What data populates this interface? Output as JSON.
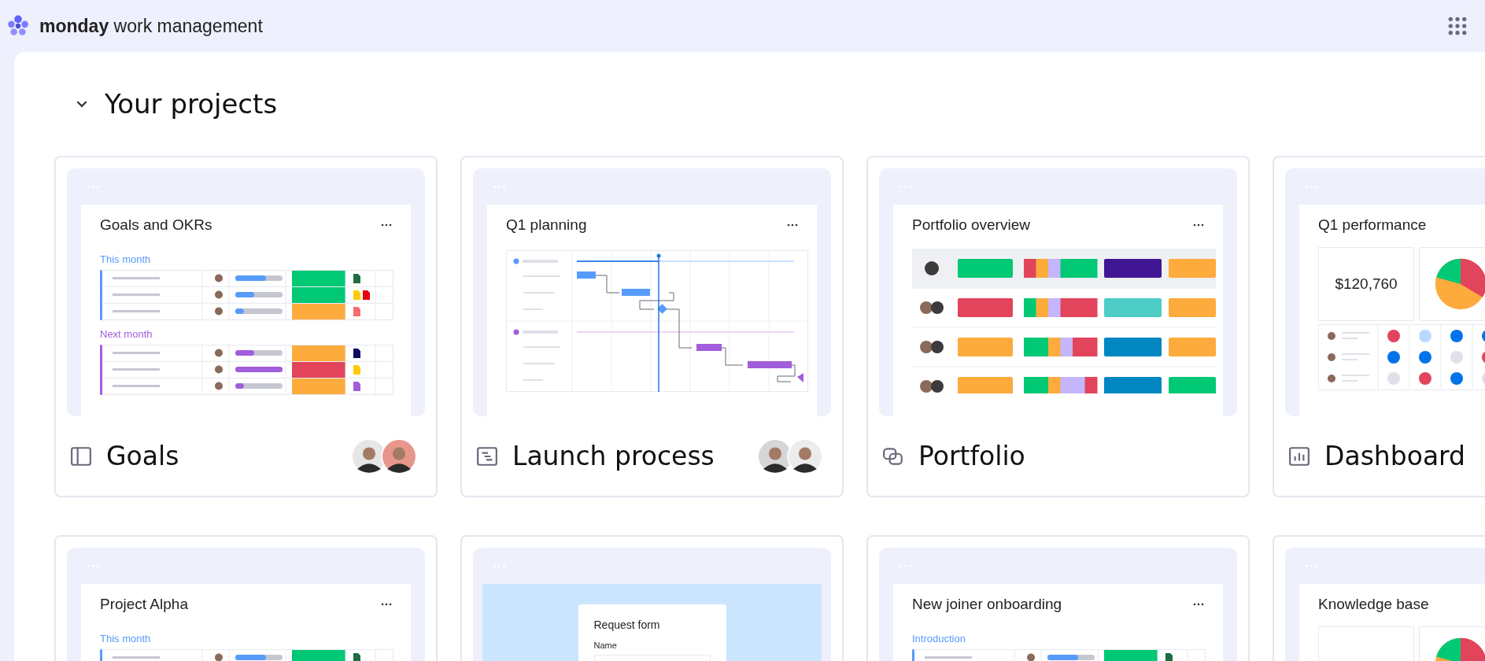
{
  "header": {
    "brand": "monday",
    "product": "work management"
  },
  "section": {
    "title": "Your projects",
    "expanded": true
  },
  "cards": [
    {
      "kind": "board",
      "title": "Goals",
      "avatars": [
        {
          "color": "#e6e6e6"
        },
        {
          "color": "#e7968c"
        }
      ],
      "preview": {
        "title": "Goals and OKRs",
        "groups": [
          {
            "label": "This month",
            "color": "#579bfc"
          },
          {
            "label": "Next month",
            "color": "#a25ddc"
          }
        ]
      }
    },
    {
      "kind": "timeline",
      "title": "Launch process",
      "avatars": [
        {
          "color": "#d6d6d6"
        },
        {
          "color": "#ececec"
        }
      ],
      "preview": {
        "title": "Q1 planning"
      }
    },
    {
      "kind": "portfolio",
      "title": "Portfolio",
      "preview": {
        "title": "Portfolio overview"
      }
    },
    {
      "kind": "dashboard",
      "title": "Dashboard",
      "preview": {
        "title": "Q1 performance",
        "value": "$120,760"
      }
    },
    {
      "kind": "board",
      "preview": {
        "title": "Project Alpha",
        "groups": [
          {
            "label": "This month",
            "color": "#579bfc"
          }
        ]
      }
    },
    {
      "kind": "form",
      "preview": {
        "title": "Request form",
        "field_label": "Name"
      }
    },
    {
      "kind": "board",
      "preview": {
        "title": "New joiner onboarding",
        "groups": [
          {
            "label": "Introduction",
            "color": "#579bfc"
          }
        ]
      }
    },
    {
      "kind": "dashboard",
      "preview": {
        "title": "Knowledge base"
      }
    }
  ]
}
